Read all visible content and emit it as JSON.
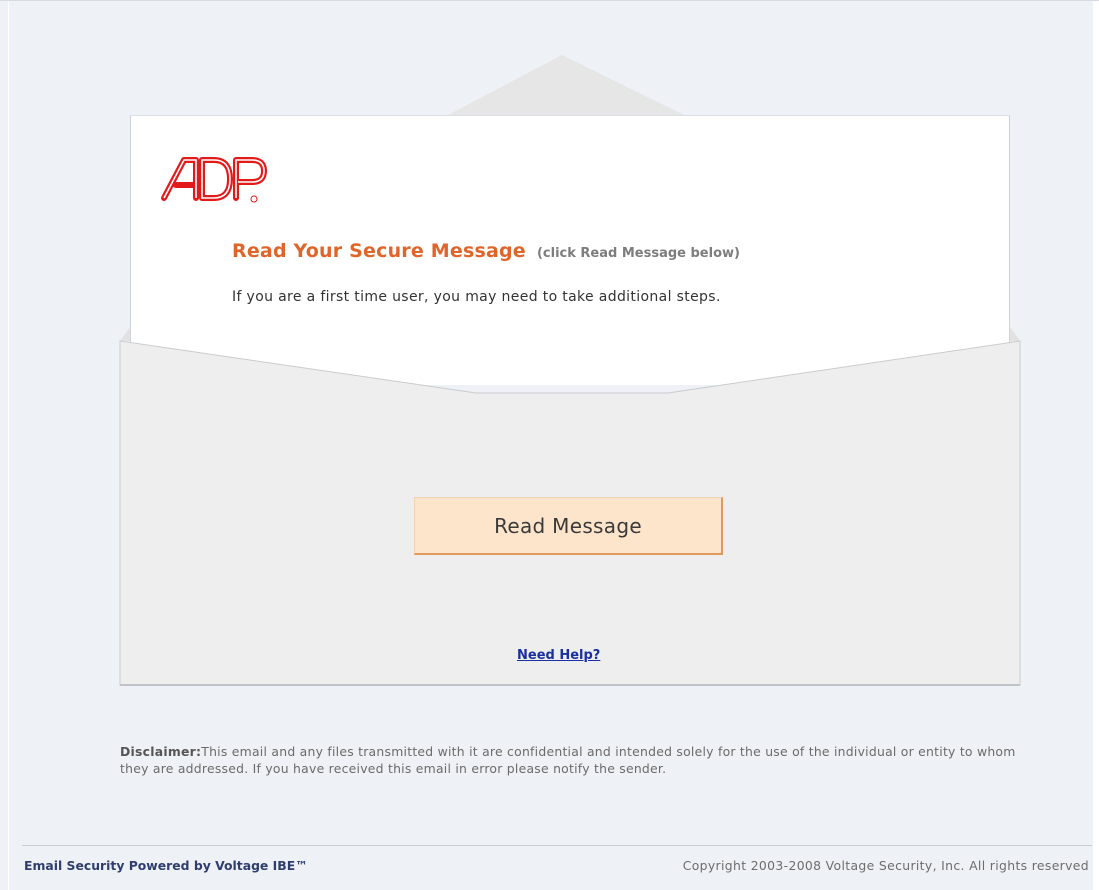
{
  "brand": {
    "logo_text": "ADP"
  },
  "message": {
    "title": "Read Your Secure Message",
    "subtitle": "(click Read Message below)",
    "intro": "If you are a first time user, you may need to take additional steps."
  },
  "actions": {
    "read_message_label": "Read Message",
    "help_link_label": "Need Help?"
  },
  "disclaimer": {
    "label": "Disclaimer:",
    "text": "This email and any files transmitted with it are confidential and intended solely for the use of the individual or entity to whom they are addressed. If you have received this email in error please notify the sender."
  },
  "footer": {
    "powered_by": "Email Security Powered by Voltage IBE™",
    "copyright": "Copyright 2003-2008 Voltage Security, Inc. All rights reserved"
  },
  "colors": {
    "accent_orange": "#e0652a",
    "brand_red": "#e21a1a",
    "button_fill": "#fde5cc",
    "link_blue": "#1a2fa0",
    "envelope_gray": "#eeeeee"
  },
  "icons": {
    "logo": "adp-logo-icon"
  }
}
